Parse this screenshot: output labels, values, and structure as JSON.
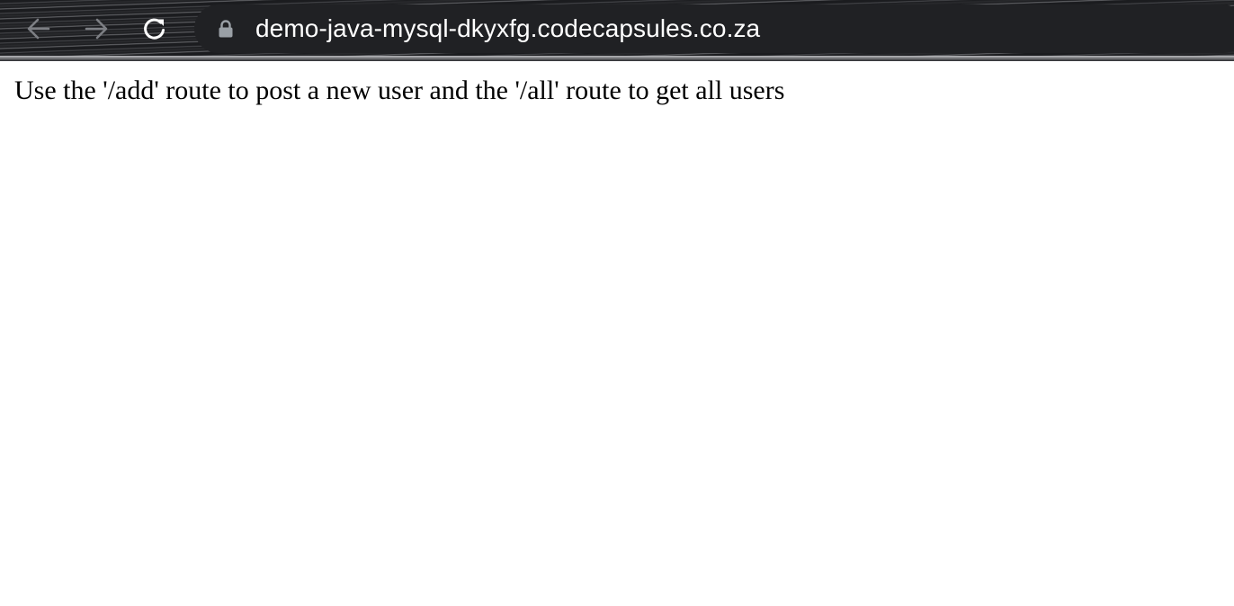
{
  "browser": {
    "address_bar": {
      "url": "demo-java-mysql-dkyxfg.codecapsules.co.za",
      "secure_icon": "lock-icon"
    },
    "nav": {
      "back_icon": "arrow-left-icon",
      "forward_icon": "arrow-right-icon",
      "reload_icon": "reload-icon"
    },
    "colors": {
      "omnibox_bg": "#202124",
      "icon_disabled": "#9aa0a6",
      "icon_enabled": "#ffffff"
    }
  },
  "page": {
    "body_text": "Use the '/add' route to post a new user and the '/all' route to get all users"
  }
}
